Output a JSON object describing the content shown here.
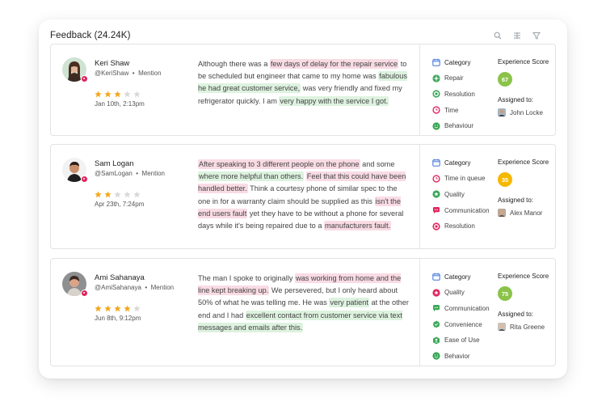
{
  "header": {
    "title": "Feedback (24.24K)"
  },
  "icons": {
    "search": "search-icon",
    "columns": "columns-icon",
    "filter": "filter-icon"
  },
  "colors": {
    "star_filled": "#f4a81d",
    "star_empty": "#d9d9d9",
    "score_green": "#8bc34a",
    "score_yellow": "#f5b800",
    "highlight_negative": "#f9dbe4",
    "highlight_positive": "#ddf2df"
  },
  "labels": {
    "category": "Category",
    "experience_score": "Experience Score",
    "assigned_to": "Assigned to:"
  },
  "feedback": [
    {
      "name": "Keri Shaw",
      "handle": "@KeriShaw",
      "type": "Mention",
      "rating": 3,
      "date": "Jan 10th, 2:13pm",
      "review": [
        {
          "t": "Although there was a ",
          "h": ""
        },
        {
          "t": "few days of delay for the repair service",
          "h": "red"
        },
        {
          "t": " to be scheduled but engineer that came to my home was ",
          "h": ""
        },
        {
          "t": "fabulous he had great customer service,",
          "h": "green"
        },
        {
          "t": " was very friendly and fixed my refrigerator quickly. I am ",
          "h": ""
        },
        {
          "t": "very happy with the service I got.",
          "h": "green"
        }
      ],
      "categories": [
        {
          "label": "Repair",
          "icon": "gear-icon",
          "color": "#3aa757"
        },
        {
          "label": "Resolution",
          "icon": "target-icon",
          "color": "#3aa757"
        },
        {
          "label": "Time",
          "icon": "clock-icon",
          "color": "#e0245e"
        },
        {
          "label": "Behaviour",
          "icon": "smile-icon",
          "color": "#3aa757"
        }
      ],
      "score": "67",
      "score_color": "#8bc34a",
      "assignee": "John Locke"
    },
    {
      "name": "Sam Logan",
      "handle": "@SamLogan",
      "type": "Mention",
      "rating": 2,
      "date": "Apr 23th, 7:24pm",
      "review": [
        {
          "t": "After speaking to 3 different people on the phone",
          "h": "red"
        },
        {
          "t": " and some ",
          "h": ""
        },
        {
          "t": "where more helpful than others.",
          "h": "green"
        },
        {
          "t": " ",
          "h": ""
        },
        {
          "t": "Feel that this could have been handled better.",
          "h": "red"
        },
        {
          "t": " Think a courtesy phone of similar spec to the one in for a warranty claim should be supplied as this ",
          "h": ""
        },
        {
          "t": "isn't the end users fault",
          "h": "red"
        },
        {
          "t": " yet they have to be without a phone for several days while it's being repaired due to a ",
          "h": ""
        },
        {
          "t": "manufacturers fault.",
          "h": "red"
        }
      ],
      "categories": [
        {
          "label": "Time in queue",
          "icon": "clock-icon",
          "color": "#e0245e"
        },
        {
          "label": "Quality",
          "icon": "star-badge-icon",
          "color": "#3aa757"
        },
        {
          "label": "Communication",
          "icon": "chat-icon",
          "color": "#e0245e"
        },
        {
          "label": "Resolution",
          "icon": "target-icon",
          "color": "#e0245e"
        }
      ],
      "score": "35",
      "score_color": "#f5b800",
      "assignee": "Alex Manor"
    },
    {
      "name": "Ami Sahanaya",
      "handle": "@AmiSahanaya",
      "type": "Mention",
      "rating": 4,
      "date": "Jun 8th,  9:12pm",
      "review": [
        {
          "t": "The man I spoke to originally ",
          "h": ""
        },
        {
          "t": "was working from home and the line kept breaking up.",
          "h": "red"
        },
        {
          "t": " We persevered, but I only heard about 50% of what he was telling me. He was ",
          "h": ""
        },
        {
          "t": "very patient",
          "h": "green"
        },
        {
          "t": " at the other end and I had ",
          "h": ""
        },
        {
          "t": "excellent contact from customer service via text messages and emails after this.",
          "h": "green"
        }
      ],
      "categories": [
        {
          "label": "Quality",
          "icon": "star-badge-icon",
          "color": "#e0245e"
        },
        {
          "label": "Communication",
          "icon": "chat-icon",
          "color": "#3aa757"
        },
        {
          "label": "Convenience",
          "icon": "check-badge-icon",
          "color": "#3aa757"
        },
        {
          "label": "Ease of Use",
          "icon": "person-icon",
          "color": "#3aa757"
        },
        {
          "label": "Behavior",
          "icon": "smile-icon",
          "color": "#3aa757"
        }
      ],
      "score": "75",
      "score_color": "#8bc34a",
      "assignee": "Rita Greene"
    }
  ]
}
